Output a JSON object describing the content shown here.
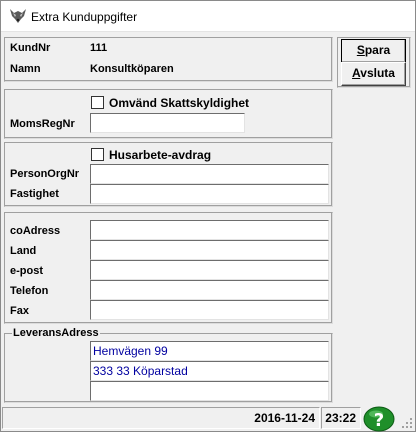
{
  "window": {
    "title": "Extra Kunduppgifter"
  },
  "customer": {
    "kundnr_label": "KundNr",
    "kundnr_value": "111",
    "namn_label": "Namn",
    "namn_value": "Konsultköparen"
  },
  "buttons": {
    "save_label": "Spara",
    "close_label": "Avsluta"
  },
  "vat": {
    "checkbox_label": "Omvänd Skattskyldighet",
    "checked": false,
    "momsregnr_label": "MomsRegNr",
    "momsregnr_value": ""
  },
  "rot": {
    "checkbox_label": "Husarbete-avdrag",
    "checked": false,
    "personorgnr_label": "PersonOrgNr",
    "personorgnr_value": "",
    "fastighet_label": "Fastighet",
    "fastighet_value": ""
  },
  "contact": {
    "coadress_label": "coAdress",
    "coadress_value": "",
    "land_label": "Land",
    "land_value": "",
    "epost_label": "e-post",
    "epost_value": "",
    "telefon_label": "Telefon",
    "telefon_value": "",
    "fax_label": "Fax",
    "fax_value": ""
  },
  "delivery": {
    "legend": "LeveransAdress",
    "lines": [
      "Hemvägen 99",
      "333 33 Köparstad",
      ""
    ]
  },
  "status": {
    "date": "2016-11-24",
    "time": "23:22"
  },
  "icons": {
    "app": "wolf-head-icon",
    "help": "help-question-icon",
    "grip": "resize-grip-icon"
  },
  "colors": {
    "field_text": "#0000a0",
    "help_green": "#1f8f2a"
  }
}
